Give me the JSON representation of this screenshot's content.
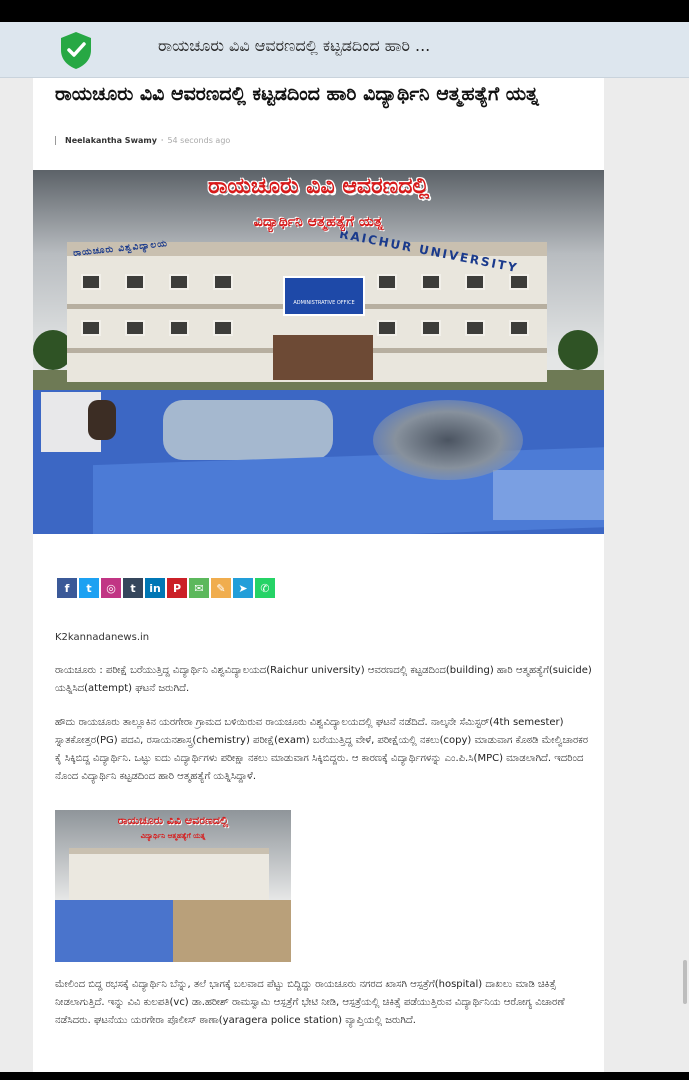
{
  "browser": {
    "tab_title": "ರಾಯಚೂರು ವಿವಿ ಆವರಣದಲ್ಲಿ ಕಟ್ಟಡದಿಂದ ಹಾರಿ ...",
    "security_icon": "shield-check-icon",
    "accent_color": "#27a844"
  },
  "article": {
    "headline": "ರಾಯಚೂರು ವಿವಿ ಆವರಣದಲ್ಲಿ ಕಟ್ಟಡದಿಂದ ಹಾರಿ ವಿದ್ಯಾರ್ಥಿನಿ ಆತ್ಮಹತ್ಯೆಗೆ ಯತ್ನ",
    "author": "Neelakantha Swamy",
    "time": "54 seconds ago",
    "hero": {
      "title": "ರಾಯಚೂರು ವಿವಿ ಆವರಣದಲ್ಲಿ",
      "subtitle": "ವಿದ್ಯಾರ್ಥಿನಿ ಆತ್ಮಹತ್ಯೆಗೆ ಯತ್ನ",
      "sign_left": "ರಾಯಚೂರು ವಿಶ್ವವಿದ್ಯಾಲಯ",
      "sign_right": "RAICHUR UNIVERSITY",
      "board_text": "ADMINISTRATIVE OFFICE"
    },
    "share_buttons": [
      {
        "name": "facebook",
        "glyph": "f",
        "color": "#3b5998"
      },
      {
        "name": "twitter",
        "glyph": "t",
        "color": "#1da1f2"
      },
      {
        "name": "instagram",
        "glyph": "◎",
        "color": "#c13584"
      },
      {
        "name": "tumblr",
        "glyph": "t",
        "color": "#35465c"
      },
      {
        "name": "linkedin",
        "glyph": "in",
        "color": "#0077b5"
      },
      {
        "name": "pinterest",
        "glyph": "P",
        "color": "#cb2027"
      },
      {
        "name": "sms",
        "glyph": "✉",
        "color": "#5cb85c"
      },
      {
        "name": "copy-link",
        "glyph": "✎",
        "color": "#f0ad4e"
      },
      {
        "name": "telegram",
        "glyph": "➤",
        "color": "#229ed9"
      },
      {
        "name": "whatsapp",
        "glyph": "✆",
        "color": "#25d366"
      }
    ],
    "source": "K2kannadanews.in",
    "paragraphs": [
      "ರಾಯಚೂರು : ಪರೀಕ್ಷೆ ಬರೆಯುತ್ತಿದ್ದ ವಿದ್ಯಾರ್ಥಿನಿ ವಿಶ್ವವಿದ್ಯಾಲಯದ(Raichur university) ಆವರಣದಲ್ಲಿ ಕಟ್ಟಡದಿಂದ(building) ಹಾರಿ ಆತ್ಮಹತ್ಯೆಗೆ(suicide) ಯತ್ನಿಸಿದ(attempt) ಘಟನೆ ಜರುಗಿದೆ.",
      "ಹೌದು ರಾಯಚೂರು ತಾಲ್ಲೂಕಿನ ಯರಗೇರಾ ಗ್ರಾಮದ ಬಳಿಯಿರುವ ರಾಯಚೂರು ವಿಶ್ವವಿದ್ಯಾಲಯದಲ್ಲಿ ಘಟನೆ ನಡೆದಿದೆ. ನಾಲ್ಕನೇ ಸೆಮಿಸ್ಟರ್(4th semester) ಸ್ನಾತಕೋತ್ತರ(PG) ಪದವಿ, ರಸಾಯನಶಾಸ್ತ್ರ(chemistry) ಪರೀಕ್ಷೆ(exam) ಬರೆಯುತ್ತಿದ್ದ ವೇಳೆ, ಪರೀಕ್ಷೆಯಲ್ಲಿ ನಕಲು(copy) ಮಾಡುವಾಗ ಕೊಠಡಿ ಮೇಲ್ವಿಚಾರಕರ ಕೈ ಸಿಕ್ಕಿಬಿದ್ದ ವಿದ್ಯಾರ್ಥಿನಿ. ಒಟ್ಟು ಐದು ವಿದ್ಯಾರ್ಥಿಗಳು ಪರೀಕ್ಷಾ ನಕಲು ಮಾಡುವಾಗ ಸಿಕ್ಕಿಬಿದ್ದರು. ಆ ಕಾರಣಕ್ಕೆ ವಿದ್ಯಾರ್ಥಿಗಳನ್ನು ಎಂ.ಪಿ.ಸಿ(MPC) ಮಾಡಲಾಗಿದೆ. ಇದರಿಂದ ನೊಂದ ವಿದ್ಯಾರ್ಥಿನಿ ಕಟ್ಟಡದಿಂದ ಹಾರಿ ಆತ್ಮಹತ್ಯೆಗೆ ಯತ್ನಿಸಿದ್ದಾಳೆ.",
      "ಮೇಲಿಂದ ಬಿದ್ದ ರಭಸಕ್ಕೆ ವಿದ್ಯಾರ್ಥಿನಿ ಬೆನ್ನು, ತಲೆ ಭಾಗಕ್ಕೆ ಬಲವಾದ ಪೆಟ್ಟು ಬಿದ್ದಿದ್ದು ರಾಯಚೂರು ನಗರದ ಖಾಸಗಿ ಆಸ್ಪತ್ರೆಗೆ(hospital) ದಾಖಲು ಮಾಡಿ ಚಿಕಿತ್ಸೆ ನೀಡಲಾಗುತ್ತಿದೆ. ಇನ್ನು ವಿವಿ ಕುಲಪತಿ(vc) ಡಾ.ಹರೀಶ್ ರಾಮಸ್ವಾಮಿ ಆಸ್ಪತ್ರೆಗೆ ಭೇಟಿ ನೀಡಿ, ಆಸ್ಪತ್ರೆಯಲ್ಲಿ ಚಿಕಿತ್ಸೆ ಪಡೆಯುತ್ತಿರುವ ವಿದ್ಯಾರ್ಥಿನಿಯ ಆರೋಗ್ಯ ವಿಚಾರಣೆ ನಡೆಸಿದರು. ಘಟನೆಯು ಯರಗೇರಾ ಪೊಲೀಸ್ ಠಾಣಾ(yaragera police station) ವ್ಯಾಪ್ತಿಯಲ್ಲಿ ಜರುಗಿದೆ."
    ],
    "thumb": {
      "title": "ರಾಯಚೂರು ವಿವಿ ಆವರಣದಲ್ಲಿ",
      "subtitle": "ವಿದ್ಯಾರ್ಥಿನಿ ಆತ್ಮಹತ್ಯೆಗೆ ಯತ್ನ"
    }
  }
}
